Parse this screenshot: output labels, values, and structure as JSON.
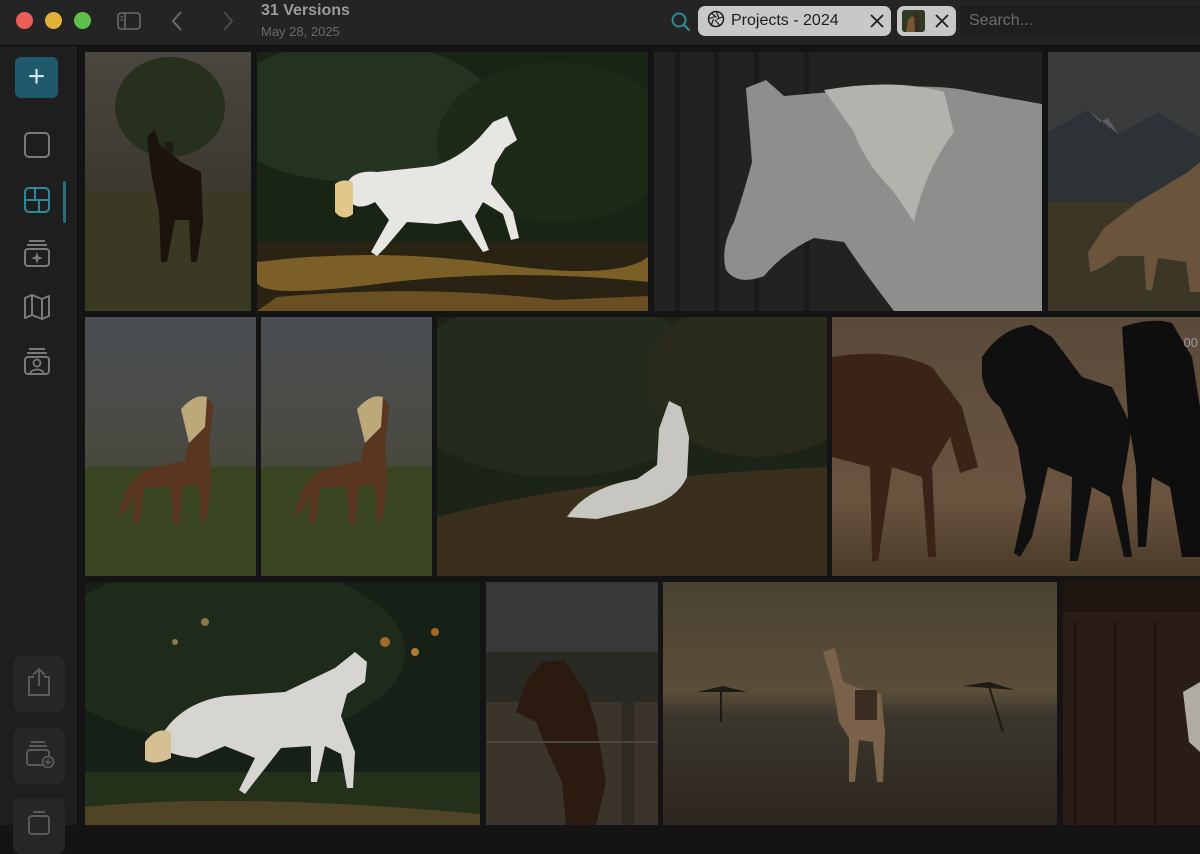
{
  "window": {
    "title": "31 Versions",
    "subtitle": "May 28, 2025"
  },
  "toolbar": {
    "project_token": "Projects - 2024",
    "search_placeholder": "Search..."
  },
  "grid": {
    "badge": "00"
  },
  "colors": {
    "accent": "#1f5a6c",
    "title_bar": "#242424",
    "sidebar": "#1e1e1e",
    "token_bg": "#c8c8c8"
  }
}
